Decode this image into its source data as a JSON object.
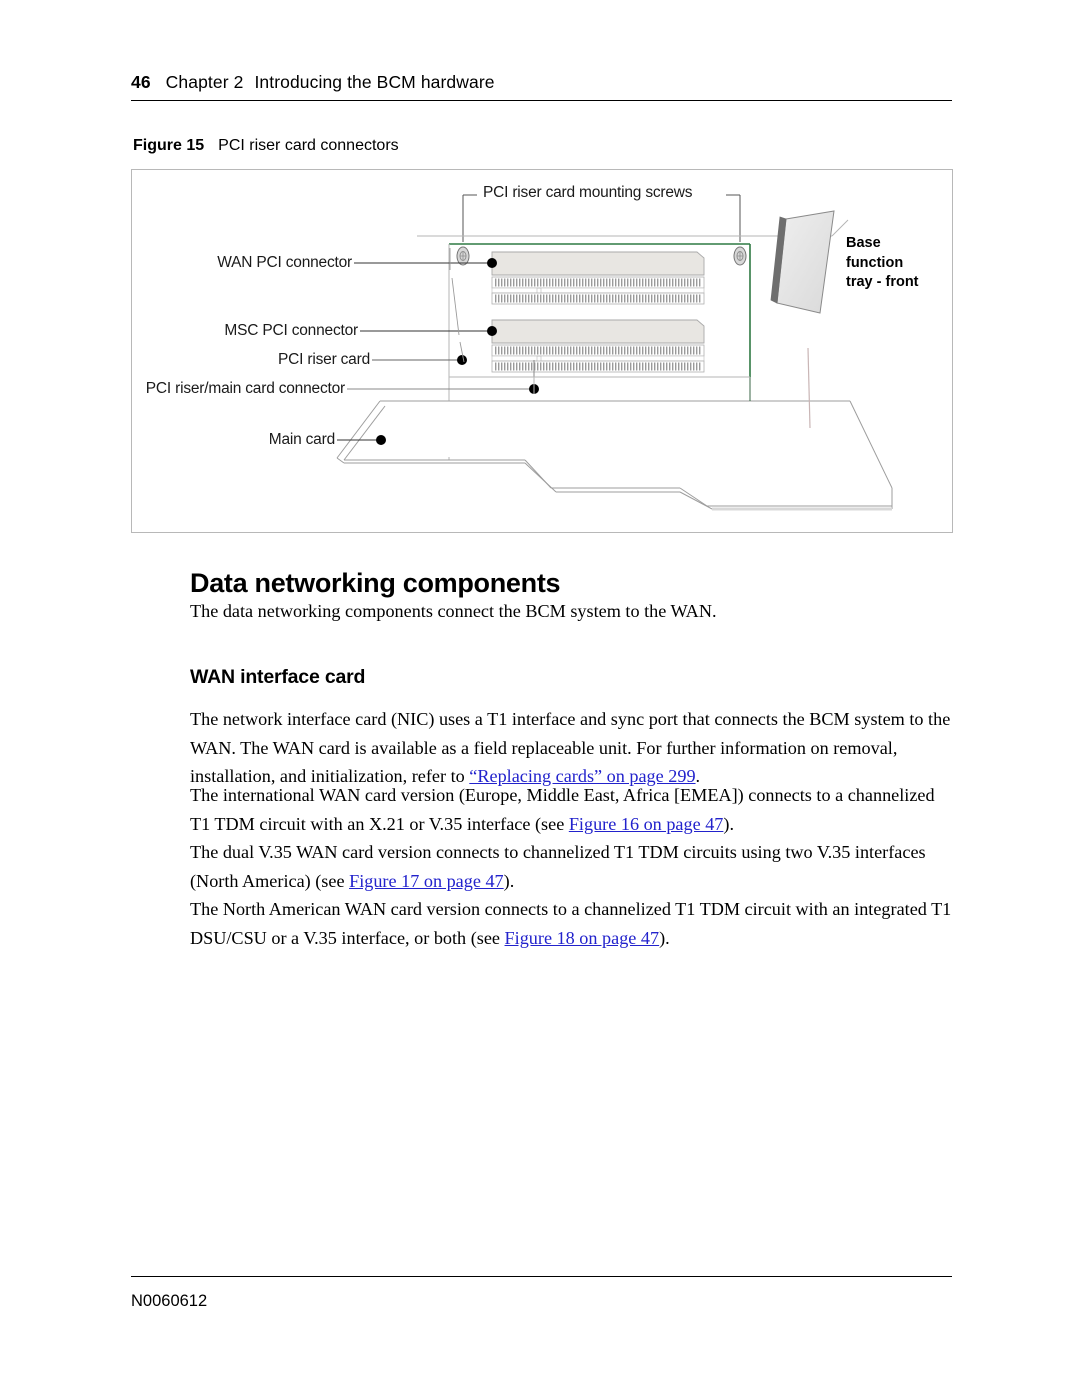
{
  "header": {
    "page_number": "46",
    "chapter": "Chapter 2",
    "title": "Introducing the BCM hardware"
  },
  "figure": {
    "label": "Figure 15",
    "title": "PCI riser card connectors",
    "labels": {
      "mounting_screws": "PCI riser card mounting screws",
      "wan_pci_connector": "WAN PCI connector",
      "msc_pci_connector": "MSC PCI connector",
      "pci_riser_card": "PCI riser card",
      "pci_riser_main_card_connector": "PCI riser/main card connector",
      "main_card": "Main card",
      "base_function_tray_line1": "Base",
      "base_function_tray_line2": "function",
      "base_function_tray_line3": "tray - front"
    },
    "colors": {
      "riser_card_outline": "#2f7a43",
      "connector_body": "#e8e6e2",
      "tray_panel": "#e4e4e4",
      "box_border": "#b8b8b8"
    }
  },
  "main": {
    "section_heading": "Data networking components",
    "section_intro": "The data networking components connect the BCM system to the WAN.",
    "subsection_heading": "WAN interface card",
    "paragraphs": [
      {
        "pre": "The network interface card (NIC) uses a T1 interface and sync port that connects the BCM system to the WAN. The WAN card is available as a field replaceable unit. For further information on removal, installation, and initialization, refer to ",
        "link": "“Replacing cards” on page 299",
        "post": "."
      },
      {
        "pre": "The international WAN card version (Europe, Middle East, Africa [EMEA]) connects to a channelized T1 TDM circuit with an X.21 or V.35 interface (see ",
        "link": "Figure 16 on page 47",
        "post": ")."
      },
      {
        "pre": "The dual V.35 WAN card version connects to channelized T1 TDM circuits using two V.35 interfaces (North America) (see ",
        "link": "Figure 17 on page 47",
        "post": ")."
      },
      {
        "pre": "The North American WAN card version connects to a channelized T1 TDM circuit with an integrated T1 DSU/CSU or a V.35 interface, or both (see ",
        "link": "Figure 18 on page 47",
        "post": ")."
      }
    ]
  },
  "footer": {
    "document_number": "N0060612"
  }
}
